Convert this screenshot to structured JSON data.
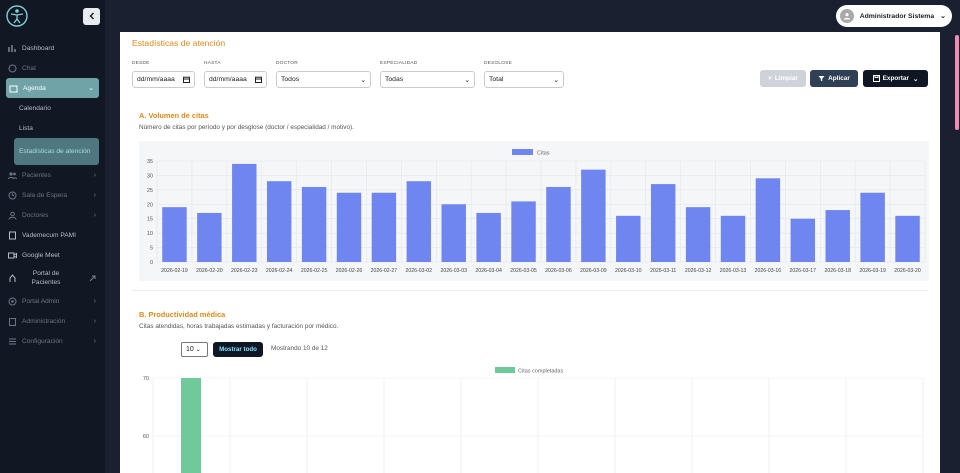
{
  "sidebar": {
    "items": [
      {
        "label": "Dashboard",
        "icon": "dashboard-icon"
      },
      {
        "label": "Chat",
        "icon": "chat-icon"
      },
      {
        "label": "Agenda",
        "icon": "calendar-icon"
      },
      {
        "label": "Pacientes",
        "icon": "users-icon"
      },
      {
        "label": "Sala de Espera",
        "icon": "clock-icon"
      },
      {
        "label": "Doctores",
        "icon": "doctor-icon"
      },
      {
        "label": "Vademecum PAMI",
        "icon": "book-icon"
      },
      {
        "label": "Google Meet",
        "icon": "video-icon"
      },
      {
        "label": "Portal de Pacientes",
        "icon": "portal-icon"
      },
      {
        "label": "Portal Admin",
        "icon": "admin-icon"
      },
      {
        "label": "Administración",
        "icon": "clipboard-icon"
      },
      {
        "label": "Configuración",
        "icon": "sliders-icon"
      }
    ],
    "agenda_sub": [
      "Calendario",
      "Lista",
      "Estadísticas de atención"
    ]
  },
  "topbar": {
    "user": "Administrador Sistema"
  },
  "page": {
    "title": "Estadísticas de atención"
  },
  "filters": {
    "desde_label": "DESDE",
    "desde_placeholder": "dd/mm/aaaa",
    "hasta_label": "HASTA",
    "hasta_placeholder": "dd/mm/aaaa",
    "doctor_label": "DOCTOR",
    "doctor_value": "Todos",
    "especialidad_label": "ESPECIALIDAD",
    "especialidad_value": "Todas",
    "desglose_label": "DESGLOSE",
    "desglose_value": "Total",
    "clear_label": "Limpiar",
    "apply_label": "Aplicar",
    "export_label": "Exportar"
  },
  "section_a": {
    "title": "A. Volumen de citas",
    "subtitle": "Número de citas por período y por desglose (doctor / especialidad / motivo)."
  },
  "section_b": {
    "title": "B. Productividad médica",
    "subtitle": "Citas atendidas, horas trabajadas estimadas y facturación por médico.",
    "page_size": "10",
    "show_all_label": "Mostrar todo",
    "showing_text": "Mostrando 10 de 12"
  },
  "colors": {
    "accent": "#e08a1b",
    "bar_a": "#6f86f0",
    "bar_b": "#6fc99a",
    "apply": "#2f3f55",
    "export": "#0f1624"
  },
  "chart_data": [
    {
      "type": "bar",
      "legend": "Citas",
      "categories": [
        "2026-02-19",
        "2026-02-20",
        "2026-02-23",
        "2026-02-24",
        "2026-02-25",
        "2026-02-26",
        "2026-02-27",
        "2026-03-02",
        "2026-03-03",
        "2026-03-04",
        "2026-03-05",
        "2026-03-06",
        "2026-03-09",
        "2026-03-10",
        "2026-03-11",
        "2026-03-12",
        "2026-03-13",
        "2026-03-16",
        "2026-03-17",
        "2026-03-18",
        "2026-03-19",
        "2026-03-20"
      ],
      "values": [
        19,
        17,
        34,
        28,
        26,
        24,
        24,
        28,
        20,
        17,
        21,
        26,
        32,
        16,
        27,
        19,
        16,
        29,
        15,
        18,
        24,
        16
      ],
      "yticks": [
        0,
        5,
        10,
        15,
        20,
        25,
        30,
        35
      ],
      "ylim": [
        0,
        35
      ]
    },
    {
      "type": "bar",
      "legend": "Citas completadas",
      "values": [
        70
      ],
      "yticks": [
        60,
        70
      ]
    }
  ]
}
